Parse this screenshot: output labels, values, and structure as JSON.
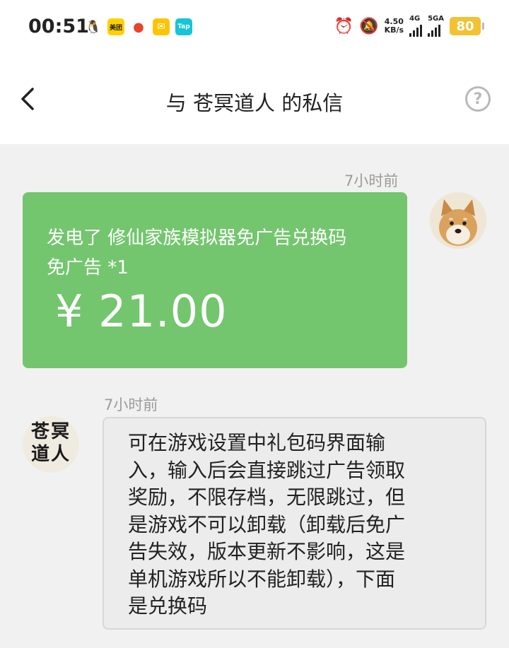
{
  "status_bar": {
    "time": "00:51",
    "notification_icons": [
      "qq-icon",
      "meituan-icon",
      "red-app-icon",
      "mail-icon",
      "taptap-icon"
    ],
    "meituan_label": "美团",
    "taptap_label": "Tap",
    "net_speed_value": "4.50",
    "net_speed_unit": "KB/s",
    "network_1": "4G",
    "network_2": "5GA",
    "battery": "80",
    "battery_color": "#f2c233"
  },
  "header": {
    "title": "与 苍冥道人 的私信",
    "help_label": "?"
  },
  "messages": [
    {
      "timestamp": "7小时前",
      "sender": "self",
      "type": "gift",
      "description": "发电了 修仙家族模拟器免广告兑换码\n免广告 *1",
      "amount": "¥ 21.00",
      "color": "#73c66e"
    },
    {
      "timestamp": "7小时前",
      "sender": "other",
      "type": "text",
      "avatar_text": "苍冥\n道人",
      "text": "可在游戏设置中礼包码界面输\n入，输入后会直接跳过广告领取\n奖励，不限存档，无限跳过，但\n是游戏不可以卸载（卸载后免广\n告失效，版本更新不影响，这是\n单机游戏所以不能卸载），下面\n是兑换码"
    }
  ]
}
